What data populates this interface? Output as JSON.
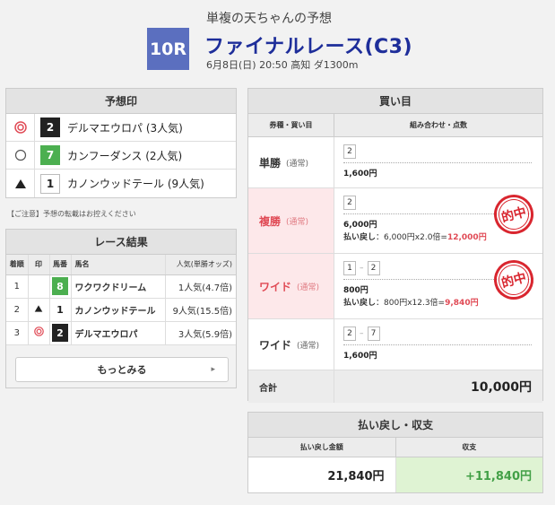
{
  "header": {
    "subtitle": "単複の天ちゃんの予想",
    "race_no": "10R",
    "race_name": "ファイナルレース(C3)",
    "meta": "6月8日(日) 20:50 高知 ダ1300m"
  },
  "prediction": {
    "title": "予想印",
    "rows": [
      {
        "mark": "◎",
        "num": "2",
        "name": "デルマエウロパ (3人気)",
        "color": "black"
      },
      {
        "mark": "○",
        "num": "7",
        "name": "カンフーダンス (2人気)",
        "color": "green"
      },
      {
        "mark": "▲",
        "num": "1",
        "name": "カノンウッドテール (9人気)",
        "color": "white"
      }
    ],
    "notice": "【ご注意】予想の転載はお控えください"
  },
  "result": {
    "title": "レース結果",
    "headers": [
      "着順",
      "印",
      "馬番",
      "馬名",
      "人気(単勝オッズ)"
    ],
    "rows": [
      {
        "rank": "1",
        "mark": "",
        "num": "8",
        "name": "ワクワクドリーム",
        "pop": "1人気(4.7倍)",
        "color": "green"
      },
      {
        "rank": "2",
        "mark": "▲",
        "num": "1",
        "name": "カノンウッドテール",
        "pop": "9人気(15.5倍)",
        "color": "white"
      },
      {
        "rank": "3",
        "mark": "◎",
        "num": "2",
        "name": "デルマエウロパ",
        "pop": "3人気(5.9倍)",
        "color": "black"
      }
    ],
    "more": "もっとみる"
  },
  "bets": {
    "title": "買い目",
    "col1": "券種・買い目",
    "col2": "組み合わせ・点数",
    "rows": [
      {
        "type": "単勝",
        "sub": "(通常)",
        "combo": [
          "2"
        ],
        "amount": "1,600円",
        "hit": false
      },
      {
        "type": "複勝",
        "sub": "(通常)",
        "combo": [
          "2"
        ],
        "amount": "6,000円",
        "hit": true,
        "pay_label": "払い戻し",
        "pay_calc": "：6,000円x2.0倍=",
        "pay_result": "12,000円"
      },
      {
        "type": "ワイド",
        "sub": "(通常)",
        "combo": [
          "1",
          "2"
        ],
        "amount": "800円",
        "hit": true,
        "pay_label": "払い戻し",
        "pay_calc": "：800円x12.3倍=",
        "pay_result": "9,840円"
      },
      {
        "type": "ワイド",
        "sub": "(通常)",
        "combo": [
          "2",
          "7"
        ],
        "amount": "1,600円",
        "hit": false
      }
    ],
    "stamp": "的中",
    "total_label": "合計",
    "total_value": "10,000円"
  },
  "payout": {
    "title": "払い戻し・収支",
    "col1": "払い戻し金額",
    "col2": "収支",
    "refund": "21,840円",
    "balance": "+11,840円"
  },
  "colors": {
    "badge": "#5b6fbf",
    "title": "#1e2e9a",
    "hit_red": "#e04a55",
    "positive_green": "#43a047"
  }
}
